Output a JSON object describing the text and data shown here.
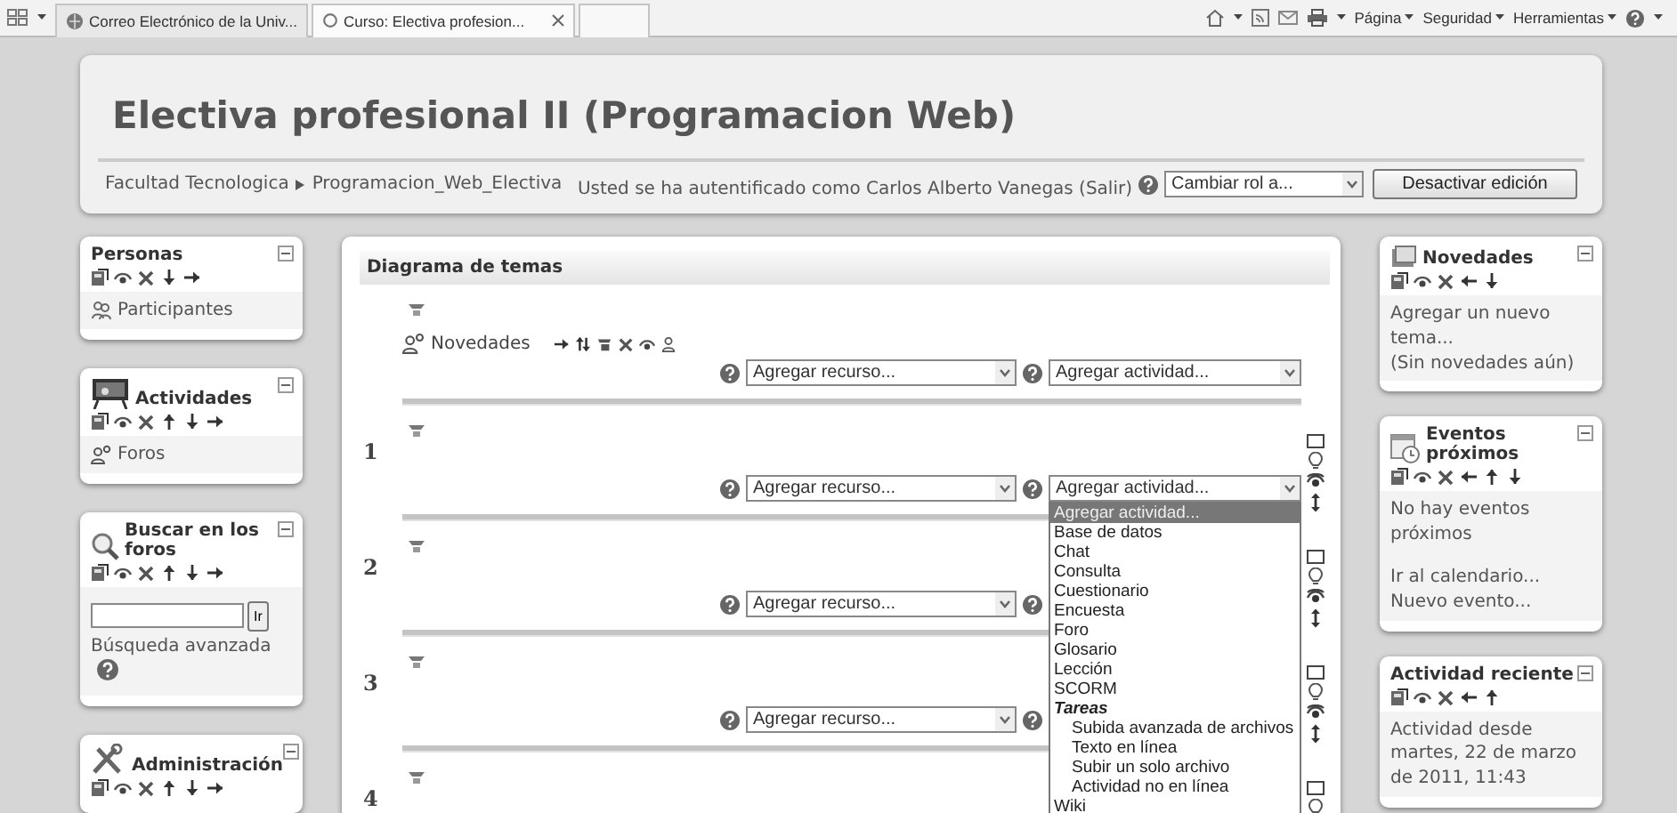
{
  "browser": {
    "tabs": [
      {
        "label": "Correo Electrónico de la Univ...",
        "selected": false
      },
      {
        "label": "Curso: Electiva profesion...",
        "selected": true
      }
    ],
    "menus": [
      "Página",
      "Seguridad",
      "Herramientas"
    ]
  },
  "header": {
    "title": "Electiva profesional II (Programacion Web)",
    "breadcrumb": [
      "Facultad Tecnologica",
      "Programacion_Web_Electiva"
    ],
    "login_text": "Usted se ha autentificado como Carlos Alberto Vanegas (Salir)",
    "role_select": "Cambiar rol a...",
    "edit_button": "Desactivar edición"
  },
  "left_blocks": [
    {
      "title": "Personas",
      "controls": [
        {
          "kind": "edit"
        },
        {
          "kind": "hide"
        },
        {
          "kind": "delete"
        },
        {
          "kind": "down"
        },
        {
          "kind": "right"
        }
      ],
      "content": [
        {
          "kind": "link",
          "text": "Participantes"
        }
      ]
    },
    {
      "title": "Actividades",
      "controls": [
        {
          "kind": "edit"
        },
        {
          "kind": "hide"
        },
        {
          "kind": "delete"
        },
        {
          "kind": "up"
        },
        {
          "kind": "down"
        },
        {
          "kind": "right"
        }
      ],
      "content": [
        {
          "kind": "link",
          "text": "Foros"
        }
      ]
    },
    {
      "title": "Buscar en los foros",
      "controls": [
        {
          "kind": "edit"
        },
        {
          "kind": "hide"
        },
        {
          "kind": "delete"
        },
        {
          "kind": "up"
        },
        {
          "kind": "down"
        },
        {
          "kind": "right"
        }
      ],
      "content": [
        {
          "kind": "search",
          "button": "Ir"
        },
        {
          "kind": "link",
          "text": "Búsqueda avanzada"
        },
        {
          "kind": "help"
        }
      ]
    },
    {
      "title": "Administración",
      "controls": [
        {
          "kind": "edit"
        },
        {
          "kind": "hide"
        },
        {
          "kind": "delete"
        },
        {
          "kind": "up"
        },
        {
          "kind": "down"
        },
        {
          "kind": "right"
        }
      ]
    }
  ],
  "center": {
    "title": "Diagrama de temas",
    "sections": [
      {
        "items": [
          {
            "text": "Novedades",
            "controls": [
              {
                "kind": "right"
              },
              {
                "kind": "move"
              },
              {
                "kind": "edit2"
              },
              {
                "kind": "delete"
              },
              {
                "kind": "hide"
              },
              {
                "kind": "group"
              }
            ]
          }
        ],
        "resource": "Agregar recurso...",
        "activity": "Agregar actividad...",
        "side_controls": false
      },
      {
        "number": "1",
        "resource": "Agregar recurso...",
        "activity": "Agregar actividad...",
        "side_controls": true,
        "activity_menu": {
          "options": [
            {
              "label": "Agregar actividad...",
              "selected": true
            },
            {
              "label": "Base de datos",
              "selected": false
            },
            {
              "label": "Chat",
              "selected": false
            },
            {
              "label": "Consulta",
              "selected": false
            },
            {
              "label": "Cuestionario",
              "selected": false
            },
            {
              "label": "Encuesta",
              "selected": false
            },
            {
              "label": "Foro",
              "selected": false
            },
            {
              "label": "Glosario",
              "selected": false
            },
            {
              "label": "Lección",
              "selected": false
            },
            {
              "label": "SCORM",
              "selected": false
            },
            {
              "label": "Tareas",
              "kind": "group",
              "selected": false,
              "children": [
                {
                  "label": "Subida avanzada de archivos",
                  "selected": false
                },
                {
                  "label": "Texto en línea",
                  "selected": false
                },
                {
                  "label": "Subir un solo archivo",
                  "selected": false
                },
                {
                  "label": "Actividad no en línea",
                  "selected": false
                }
              ]
            },
            {
              "label": "Wiki",
              "selected": false
            }
          ]
        }
      },
      {
        "number": "2",
        "resource": "Agregar recurso...",
        "side_controls": true
      },
      {
        "number": "3",
        "resource": "Agregar recurso...",
        "side_controls": true
      },
      {
        "number": "4",
        "side_controls": true
      }
    ]
  },
  "right_blocks": [
    {
      "title": "Novedades",
      "controls": [
        {
          "kind": "edit"
        },
        {
          "kind": "hide"
        },
        {
          "kind": "delete"
        },
        {
          "kind": "left"
        },
        {
          "kind": "down"
        }
      ],
      "content": [
        {
          "kind": "link",
          "text": "Agregar un nuevo tema..."
        },
        {
          "kind": "text",
          "text": "(Sin novedades aún)"
        }
      ]
    },
    {
      "title": "Eventos próximos",
      "controls": [
        {
          "kind": "edit"
        },
        {
          "kind": "hide"
        },
        {
          "kind": "delete"
        },
        {
          "kind": "left"
        },
        {
          "kind": "up"
        },
        {
          "kind": "down"
        }
      ],
      "content": [
        {
          "kind": "text",
          "text": "No hay eventos próximos"
        },
        {
          "kind": "link",
          "text": "Ir al calendario..."
        },
        {
          "kind": "link",
          "text": "Nuevo evento..."
        }
      ]
    },
    {
      "title": "Actividad reciente",
      "controls": [
        {
          "kind": "edit"
        },
        {
          "kind": "hide"
        },
        {
          "kind": "delete"
        },
        {
          "kind": "left"
        },
        {
          "kind": "up"
        }
      ],
      "content": [
        {
          "kind": "text",
          "text": "Actividad desde martes, 22 de marzo de 2011, 11:43"
        }
      ]
    }
  ]
}
